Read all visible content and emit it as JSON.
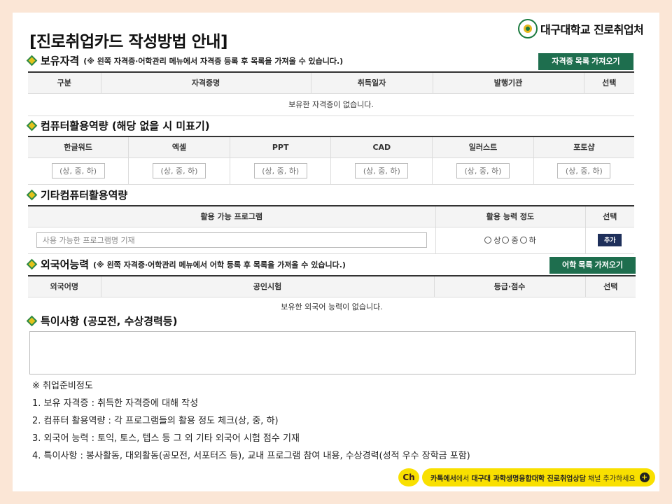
{
  "title": "[진로취업카드 작성방법 안내]",
  "logo_text": "대구대학교 진로취업처",
  "certs": {
    "title": "보유자격",
    "note": "(※ 왼쪽 자격증·어학관리 메뉴에서 자격증 등록 후 목록을 가져올 수 있습니다.)",
    "button": "자격증 목록 가져오기",
    "columns": [
      "구분",
      "자격증명",
      "취득일자",
      "발행기관",
      "선택"
    ],
    "empty": "보유한 자격증이 없습니다."
  },
  "computer": {
    "title": "컴퓨터활용역량 (해당 없을 시 미표기)",
    "columns": [
      "한글워드",
      "엑셀",
      "PPT",
      "CAD",
      "일러스트",
      "포토샵"
    ],
    "placeholder": "(상, 중, 하)"
  },
  "other": {
    "title": "기타컴퓨터활용역량",
    "columns": [
      "활용 가능 프로그램",
      "활용 능력 정도",
      "선택"
    ],
    "placeholder": "사용 가능한 프로그램명 기재",
    "radio": [
      "상",
      "중",
      "하"
    ],
    "add": "추가"
  },
  "lang": {
    "title": "외국어능력",
    "note": "(※ 왼쪽 자격증·어학관리 메뉴에서 어학 등록 후 목록을 가져올 수 있습니다.)",
    "button": "어학 목록 가져오기",
    "columns": [
      "외국어명",
      "공인시험",
      "등급·점수",
      "선택"
    ],
    "empty": "보유한 외국어 능력이 없습니다."
  },
  "special": {
    "title": "특이사항 (공모전, 수상경력등)"
  },
  "notes": [
    "※  취업준비정도",
    "1. 보유 자격증 : 취득한 자격증에 대해 작성",
    "2. 컴퓨터 활용역량 : 각 프로그램들의 활용 정도 체크(상, 중, 하)",
    "3. 외국어 능력 : 토익, 토스, 텝스 등 그 외 기타 외국어 시험 점수 기재",
    "4. 특이사항 : 봉사활동, 대외활동(공모전, 서포터즈 등), 교내 프로그램 참여 내용, 수상경력(성적 우수 장학금 포함)"
  ],
  "kakao": {
    "ch": "Ch",
    "prefix": "카톡에서",
    "channel": "대구대 과학생명융합대학 진로취업상담",
    "suffix": "채널 추가하세요",
    "plus": "+"
  },
  "colors": {
    "accent_green": "#1e6e4e",
    "kakao_yellow": "#f9e000",
    "add_navy": "#1e2f5a"
  }
}
